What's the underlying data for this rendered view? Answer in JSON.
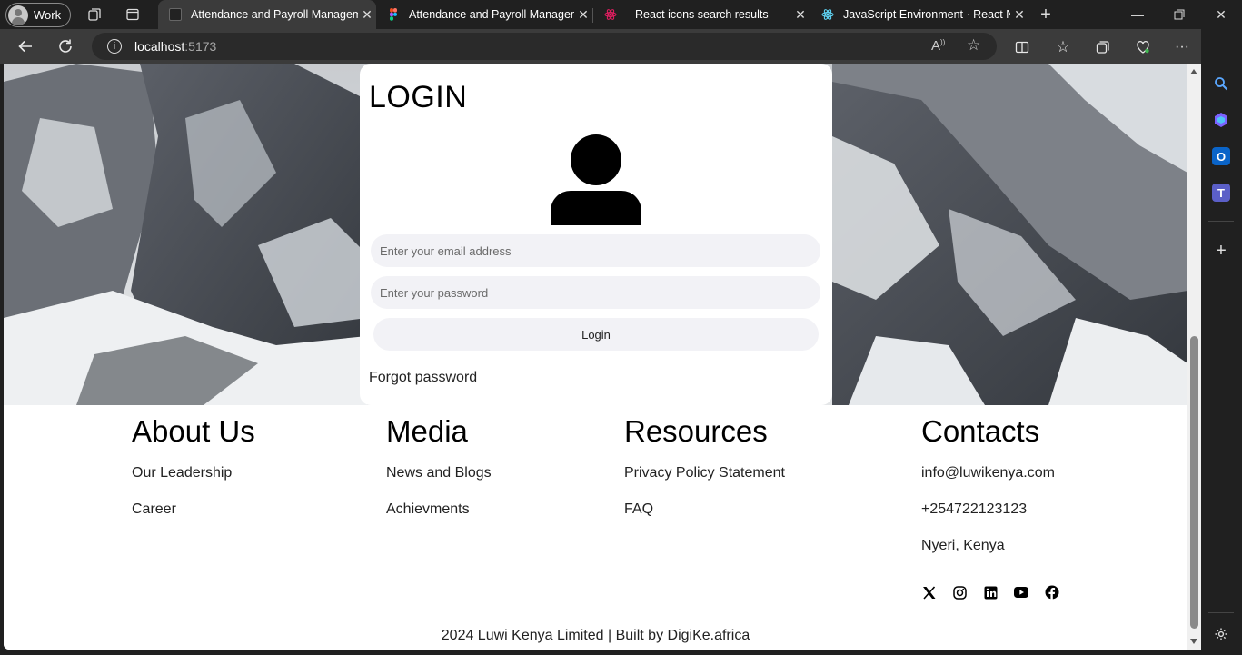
{
  "browser": {
    "profile": "Work",
    "tabs": [
      {
        "title": "Attendance and Payroll Management",
        "favicon": "luwi-icon",
        "active": true
      },
      {
        "title": "Attendance and Payroll Management",
        "favicon": "figma-icon",
        "active": false
      },
      {
        "title": "React icons search results",
        "favicon": "react-icons-icon",
        "active": false
      },
      {
        "title": "JavaScript Environment · React Native",
        "favicon": "react-icon",
        "active": false
      }
    ],
    "url_host": "localhost",
    "url_port": ":5173"
  },
  "login": {
    "title": "LOGIN",
    "email_placeholder": "Enter your email address",
    "password_placeholder": "Enter your password",
    "button_label": "Login",
    "forgot_label": "Forgot password"
  },
  "footer": {
    "columns": [
      {
        "heading": "About Us",
        "links": [
          "Our Leadership",
          "Career"
        ]
      },
      {
        "heading": "Media",
        "links": [
          "News and Blogs",
          "Achievments"
        ]
      },
      {
        "heading": "Resources",
        "links": [
          "Privacy Policy Statement",
          "FAQ"
        ]
      },
      {
        "heading": "Contacts",
        "links": [
          "info@luwikenya.com",
          "+254722123123",
          "Nyeri, Kenya"
        ]
      }
    ],
    "social": [
      "x-icon",
      "instagram-icon",
      "linkedin-icon",
      "youtube-icon",
      "facebook-icon"
    ],
    "copyright": "2024 Luwi Kenya Limited | Built by DigiKe.africa"
  },
  "colors": {
    "browser_bg": "#202020",
    "toolbar_bg": "#3b3b3b",
    "input_bg": "#f2f2f6"
  }
}
